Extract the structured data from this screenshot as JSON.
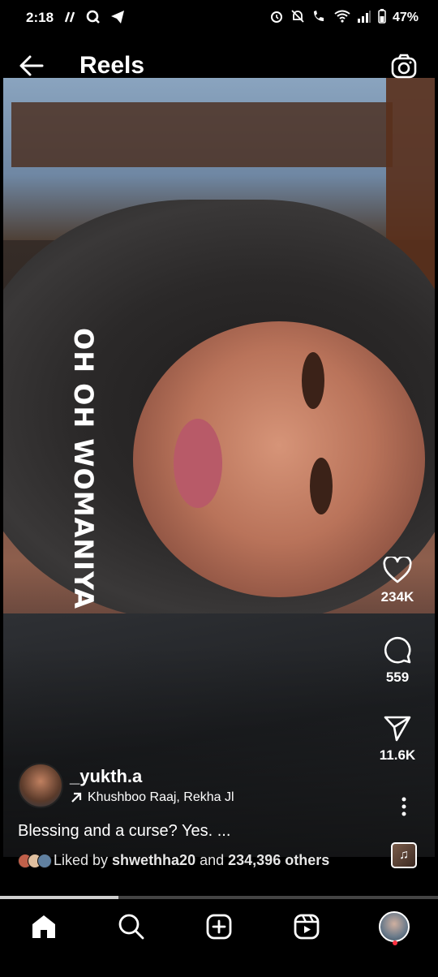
{
  "status_bar": {
    "time": "2:18",
    "battery": "47%",
    "left_icons": [
      "n-icon",
      "q-icon",
      "telegram-icon"
    ],
    "right_icons": [
      "alarm-icon",
      "mute-icon",
      "wifi-call-icon",
      "wifi-icon",
      "signal-icon",
      "battery-icon"
    ]
  },
  "header": {
    "title": "Reels",
    "back_icon": "arrow-left-icon",
    "camera_icon": "camera-icon"
  },
  "reel": {
    "overlay_text": "OH OH WOMANIYA",
    "likes": "234K",
    "comments": "559",
    "shares": "11.6K",
    "username": "_yukth.a",
    "audio": "Khushboo Raaj, Rekha Jl",
    "caption": "Blessing and a curse? Yes. ...",
    "liked_by": {
      "prefix": "Liked by ",
      "user": "shwethha20",
      "middle": " and ",
      "count": "234,396 others"
    },
    "progress": 0.27
  },
  "nav": {
    "items": [
      "home-icon",
      "search-icon",
      "create-icon",
      "reels-icon",
      "profile-avatar"
    ]
  },
  "colors": {
    "background": "#000000",
    "text": "#ffffff",
    "notification_dot": "#ff3040"
  }
}
